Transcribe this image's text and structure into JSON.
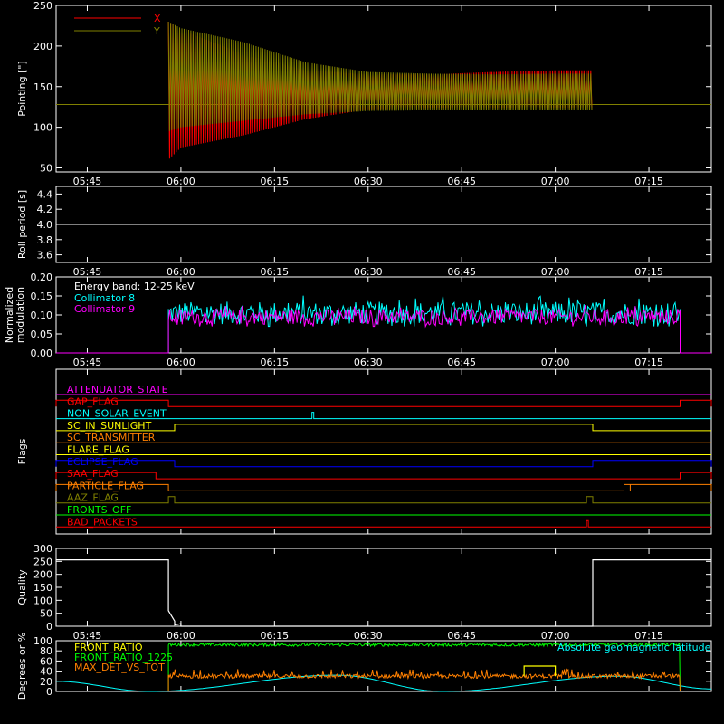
{
  "chart_data": [
    {
      "type": "line",
      "ylabel": "Pointing [\"]",
      "ylim": [
        45,
        250
      ],
      "yticks": [
        50,
        100,
        150,
        200,
        250
      ],
      "x_ticks": [
        "05:45",
        "06:00",
        "06:15",
        "06:30",
        "06:45",
        "07:00",
        "07:15"
      ],
      "x_range": [
        "05:40",
        "07:25"
      ],
      "legend_position": "top-left",
      "series": [
        {
          "name": "X",
          "color": "#ff0000",
          "segments": [
            {
              "x": [
                "05:58",
                "06:00",
                "06:10",
                "06:20",
                "06:30",
                "06:40",
                "06:50",
                "07:00",
                "07:06"
              ],
              "lower": [
                60,
                75,
                90,
                110,
                122,
                124,
                124,
                124,
                124
              ],
              "upper": [
                230,
                220,
                190,
                170,
                165,
                165,
                168,
                170,
                170
              ]
            }
          ]
        },
        {
          "name": "Y",
          "color": "#808000",
          "baseline": 128,
          "segments": [
            {
              "x": [
                "05:58",
                "06:00",
                "06:10",
                "06:20",
                "06:30",
                "06:40",
                "06:50",
                "07:00",
                "07:06"
              ],
              "lower": [
                95,
                100,
                108,
                116,
                120,
                121,
                121,
                121,
                121
              ],
              "upper": [
                230,
                222,
                205,
                180,
                168,
                166,
                165,
                166,
                166
              ]
            }
          ]
        }
      ]
    },
    {
      "type": "line",
      "ylabel": "Roll period [s]",
      "ylim": [
        3.5,
        4.5
      ],
      "yticks": [
        3.6,
        3.8,
        4.0,
        4.2,
        4.4
      ],
      "x_ticks": [
        "05:45",
        "06:00",
        "06:15",
        "06:30",
        "06:45",
        "07:00",
        "07:15"
      ],
      "series": [
        {
          "color": "#ffffff",
          "value": 4.0
        }
      ]
    },
    {
      "type": "line",
      "ylabel": "Normalized modulation",
      "ylim": [
        0,
        0.2
      ],
      "yticks": [
        0.0,
        0.05,
        0.1,
        0.15,
        0.2
      ],
      "x_ticks": [
        "05:45",
        "06:00",
        "06:15",
        "06:30",
        "06:45",
        "07:00",
        "07:15"
      ],
      "annotation": "Energy band: 12-25 keV",
      "series": [
        {
          "name": "Collimator 8",
          "color": "#00ffff",
          "x_start": "05:58",
          "x_end": "07:20",
          "mean": 0.105,
          "spread": 0.03
        },
        {
          "name": "Collimator 9",
          "color": "#ff00ff",
          "x_start": "05:58",
          "x_end": "07:20",
          "mean": 0.095,
          "spread": 0.02
        }
      ]
    },
    {
      "type": "line",
      "ylabel": "Flags",
      "series": [
        {
          "name": "ATTENUATOR_STATE",
          "color": "#ff00ff",
          "high": []
        },
        {
          "name": "GAP_FLAG",
          "color": "#ff0000",
          "high": [
            [
              "05:40",
              "05:58"
            ],
            [
              "07:20",
              "07:25"
            ]
          ]
        },
        {
          "name": "NON_SOLAR_EVENT",
          "color": "#00ffff",
          "high": [
            [
              "06:21",
              "06:21"
            ]
          ]
        },
        {
          "name": "SC_IN_SUNLIGHT",
          "color": "#ffff00",
          "high": [
            [
              "05:59",
              "07:06"
            ]
          ]
        },
        {
          "name": "SC_TRANSMITTER",
          "color": "#ff8000",
          "high": []
        },
        {
          "name": "FLARE_FLAG",
          "color": "#ffff00",
          "high": []
        },
        {
          "name": "ECLIPSE_FLAG",
          "color": "#0000ff",
          "high": [
            [
              "05:40",
              "05:59"
            ],
            [
              "07:06",
              "07:25"
            ]
          ]
        },
        {
          "name": "SAA_FLAG",
          "color": "#ff0000",
          "high": [
            [
              "05:40",
              "05:56"
            ],
            [
              "07:20",
              "07:25"
            ]
          ]
        },
        {
          "name": "PARTICLE_FLAG",
          "color": "#ff8000",
          "high": [
            [
              "05:40",
              "05:58"
            ],
            [
              "07:11",
              "07:12"
            ],
            [
              "07:12",
              "07:25"
            ]
          ]
        },
        {
          "name": "AAZ_FLAG",
          "color": "#808000",
          "high": [
            [
              "05:58",
              "05:59"
            ],
            [
              "07:05",
              "07:06"
            ]
          ]
        },
        {
          "name": "FRONTS_OFF",
          "color": "#00ff00",
          "high": []
        },
        {
          "name": "BAD_PACKETS",
          "color": "#ff0000",
          "high": [
            [
              "07:05",
              "07:05"
            ]
          ]
        }
      ]
    },
    {
      "type": "line",
      "ylabel": "Quality",
      "ylim": [
        0,
        300
      ],
      "yticks": [
        0,
        50,
        100,
        150,
        200,
        250,
        300
      ],
      "x_ticks": [
        "05:45",
        "06:00",
        "06:15",
        "06:30",
        "06:45",
        "07:00",
        "07:15"
      ],
      "series": [
        {
          "color": "#ffffff",
          "points": [
            [
              "05:40",
              256
            ],
            [
              "05:58",
              256
            ],
            [
              "05:58",
              60
            ],
            [
              "05:59",
              20
            ],
            [
              "05:59",
              5
            ],
            [
              "06:00",
              10
            ],
            [
              "06:00",
              0
            ],
            [
              "07:06",
              0
            ],
            [
              "07:06",
              256
            ],
            [
              "07:25",
              256
            ]
          ]
        }
      ]
    },
    {
      "type": "line",
      "ylabel": "Degrees or %",
      "ylim": [
        0,
        100
      ],
      "yticks": [
        0,
        20,
        40,
        60,
        80,
        100
      ],
      "series": [
        {
          "name": "FRONT_RATIO",
          "color": "#ffff00",
          "points": [
            [
              "06:55",
              50
            ],
            [
              "07:00",
              50
            ]
          ]
        },
        {
          "name": "FRONT_RATIO_1225",
          "color": "#00ff00",
          "x_start": "05:58",
          "x_end": "07:20",
          "mean": 92,
          "spread": 3
        },
        {
          "name": "MAX_DET_VS_TOT",
          "color": "#ff8000",
          "x_start": "05:58",
          "x_end": "07:20",
          "mean": 30,
          "spread": 4
        },
        {
          "name": "Absolute geomagnetic latitude",
          "color": "#00ffff",
          "points": [
            [
              "05:40",
              20
            ],
            [
              "05:55",
              0
            ],
            [
              "06:25",
              32
            ],
            [
              "06:42",
              0
            ],
            [
              "07:10",
              30
            ],
            [
              "07:25",
              5
            ]
          ]
        }
      ]
    }
  ]
}
